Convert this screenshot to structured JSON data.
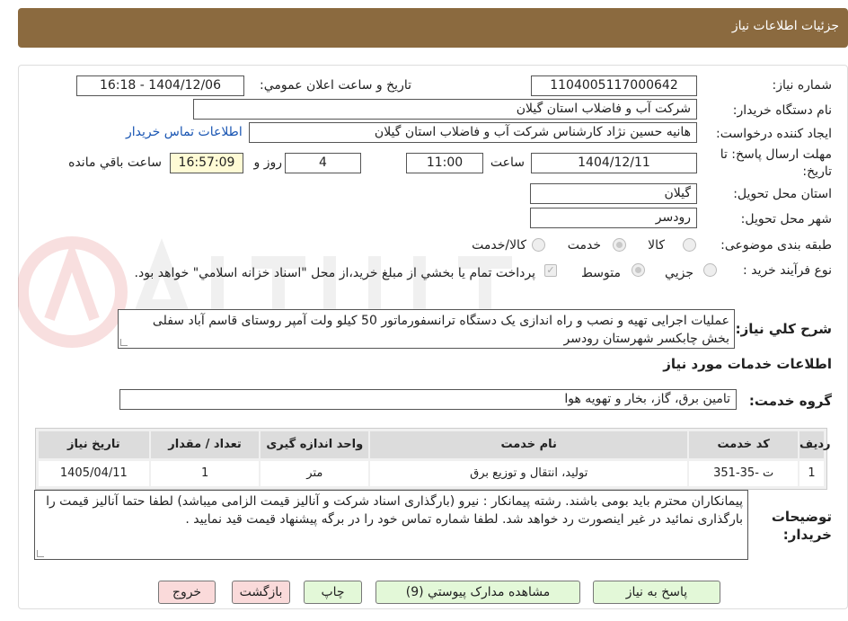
{
  "header": {
    "title": "جزئیات اطلاعات نیاز"
  },
  "fields": {
    "need_number_label": "شماره نیاز:",
    "need_number": "1104005117000642",
    "announce_label": "تاريخ و ساعت اعلان عمومي:",
    "announce_value": "1404/12/06 - 16:18",
    "buyer_org_label": "نام دستگاه خريدار:",
    "buyer_org": "شرکت آب و فاضلاب استان گيلان",
    "creator_label": "ايجاد کننده درخواست:",
    "creator": "هانيه حسين نژاد کارشناس شرکت آب و فاضلاب استان گيلان",
    "contact_link": "اطلاعات تماس خريدار",
    "deadline_label": "مهلت ارسال پاسخ: تا",
    "deadline_label2": "تاريخ:",
    "deadline_date": "1404/12/11",
    "time_label": "ساعت",
    "deadline_time": "11:00",
    "days_value": "4",
    "days_label": "روز و",
    "remaining_time": "16:57:09",
    "remaining_label": "ساعت باقي مانده",
    "province_label": "استان محل تحويل:",
    "province": "گيلان",
    "city_label": "شهر محل تحويل:",
    "city": "رودسر",
    "category_label": "طبقه بندی موضوعی:",
    "category_options": [
      "کالا",
      "خدمت",
      "کالا/خدمت"
    ],
    "category_selected": "خدمت",
    "process_label": "نوع فرآيند خريد :",
    "process_options": [
      "جزيي",
      "متوسط"
    ],
    "process_selected": "متوسط",
    "payment_note": "پرداخت تمام يا بخشي از مبلغ خريد،از محل \"اسناد خزانه اسلامي\" خواهد بود.",
    "payment_checked": true,
    "description_label": "شرح کلي نياز:",
    "description": "عملیات اجرایی تهیه و نصب و راه اندازی یک دستگاه ترانسفورماتور 50 کیلو ولت آمپر روستای قاسم آباد سفلی بخش چابکسر شهرستان رودسر"
  },
  "services": {
    "section_title": "اطلاعات خدمات مورد نياز",
    "group_label": "گروه خدمت:",
    "group_value": "تامين برق، گاز، بخار و تهويه هوا",
    "columns": [
      "رديف",
      "کد خدمت",
      "نام خدمت",
      "واحد اندازه گيری",
      "تعداد / مقدار",
      "تاريخ نياز"
    ],
    "rows": [
      [
        "1",
        "ت -35-351",
        "توليد، انتقال و توزيع برق",
        "متر",
        "1",
        "1405/04/11"
      ]
    ]
  },
  "notes": {
    "label_line1": "توضيحات",
    "label_line2": "خريدار:",
    "text": "پیمانکاران محترم باید بومی باشند.  رشته پیمانکار :  نیرو (بارگذاری اسناد شرکت و آنالیز قیمت  الزامی میباشد) لطفا حتما آنالیز قیمت را بارگذاری نمائید در غیر اینصورت رد خواهد شد. لطفا شماره تماس خود را در برگه پیشنهاد قیمت قید نمایید ."
  },
  "buttons": {
    "reply": "پاسخ به نياز",
    "attachments": "مشاهده مدارک پيوستي (9)",
    "print": "چاپ",
    "back": "بازگشت",
    "exit": "خروج"
  },
  "colors": {
    "header": "#8b6a3f",
    "green_button": "#e3f8d8",
    "pink_button": "#fadada",
    "link": "#1a56b3"
  }
}
